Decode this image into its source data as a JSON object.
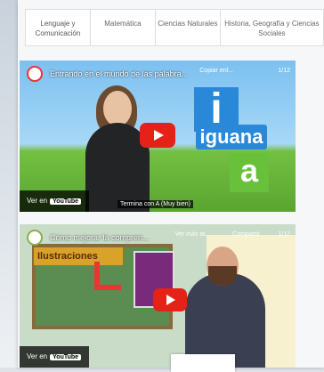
{
  "tabs": [
    {
      "label": "Lenguaje y Comunicación"
    },
    {
      "label": "Matemática"
    },
    {
      "label": "Ciencias Naturales"
    },
    {
      "label": "Historia, Geografía y Ciencias Sociales"
    }
  ],
  "videos": [
    {
      "title": "Entrando en el mundo de las palabra...",
      "copy": "Copiar enl...",
      "count": "1/12",
      "word": "iguana",
      "letter": "a",
      "letter_top": "i",
      "caption": "Termina con A (Muy bien)",
      "watch": "Ver en",
      "yt": "YouTube"
    },
    {
      "title": "Cómo mejorar la compren...",
      "later": "Ver más ta...",
      "share": "Compartir",
      "count": "1/12",
      "board": "Ilustraciones",
      "watch": "Ver en",
      "yt": "YouTube"
    }
  ]
}
